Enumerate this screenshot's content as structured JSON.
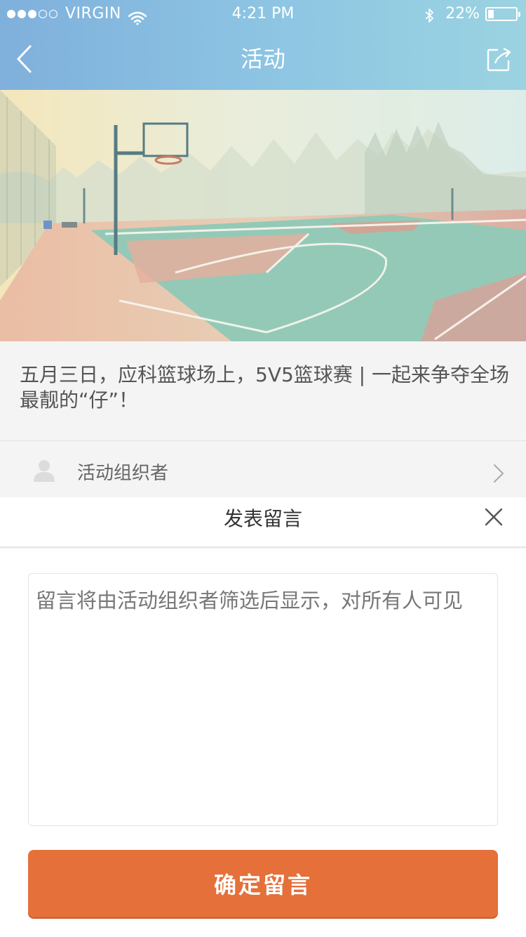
{
  "status_bar": {
    "signal_dots": [
      true,
      true,
      true,
      false,
      false
    ],
    "carrier": "VIRGIN",
    "time": "4:21 PM",
    "battery_percent_text": "22%",
    "battery_level": 0.22,
    "icons": [
      "wifi-icon",
      "bluetooth-icon",
      "battery-icon"
    ]
  },
  "nav": {
    "title": "活动",
    "back_icon": "chevron-left-icon",
    "share_icon": "share-icon"
  },
  "hero": {
    "image": "basketball-court-photo"
  },
  "event": {
    "title": "五月三日，应科篮球场上，5V5篮球赛 | 一起来争夺全场最靓的“仔”！"
  },
  "organizer": {
    "label": "活动组织者",
    "icon": "person-icon"
  },
  "comment_sheet": {
    "title": "发表留言",
    "close_icon": "close-icon",
    "placeholder": "留言将由活动组织者筛选后显示，对所有人可见",
    "value": "",
    "submit_label": "确定留言"
  },
  "colors": {
    "header_gradient_start": "#7fb0dc",
    "header_gradient_end": "#9bd3e1",
    "accent": "#e5703a",
    "background": "#f4f4f4"
  }
}
